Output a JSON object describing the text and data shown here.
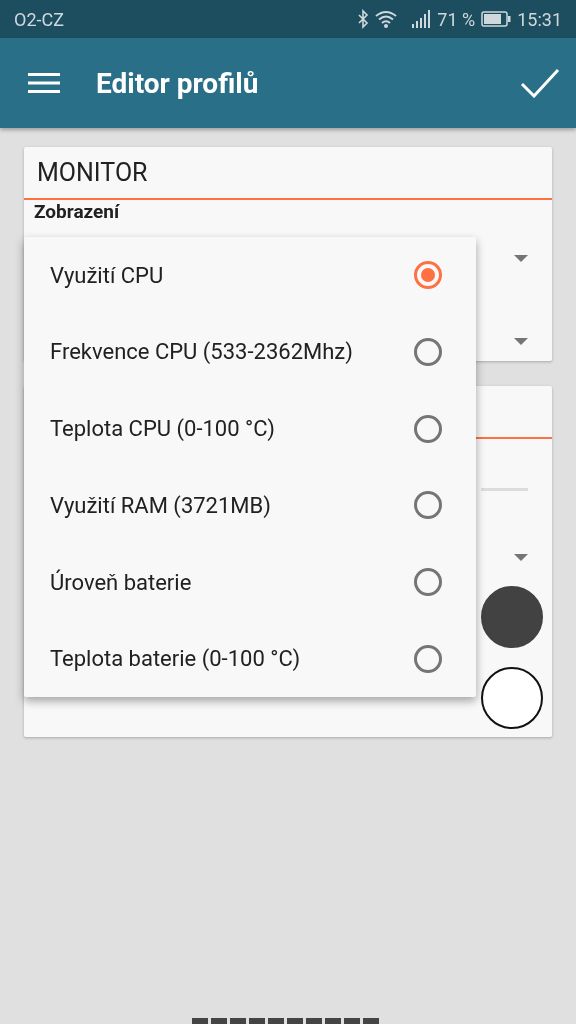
{
  "status_bar": {
    "carrier": "O2-CZ",
    "battery": "71 %",
    "time": "15:31"
  },
  "app_bar": {
    "title": "Editor profilů"
  },
  "cards": [
    {
      "title": "MONITOR",
      "rows": [
        {
          "kind": "label",
          "label": "Zobrazení"
        },
        {
          "kind": "dropdown"
        },
        {
          "kind": "dropdown"
        }
      ]
    },
    {
      "rows": [
        {
          "kind": "slider"
        },
        {
          "kind": "dropdown"
        },
        {
          "kind": "swatch",
          "color": "#424242"
        },
        {
          "kind": "swatch",
          "color": "#ffffff"
        }
      ]
    }
  ],
  "popup": {
    "options": [
      {
        "label": "Využití CPU",
        "selected": true
      },
      {
        "label": "Frekvence CPU (533-2362Mhz)",
        "selected": false
      },
      {
        "label": "Teplota CPU (0-100 °C)",
        "selected": false
      },
      {
        "label": "Využití RAM (3721MB)",
        "selected": false
      },
      {
        "label": "Úroveň baterie",
        "selected": false
      },
      {
        "label": "Teplota baterie (0-100 °C)",
        "selected": false
      }
    ]
  }
}
